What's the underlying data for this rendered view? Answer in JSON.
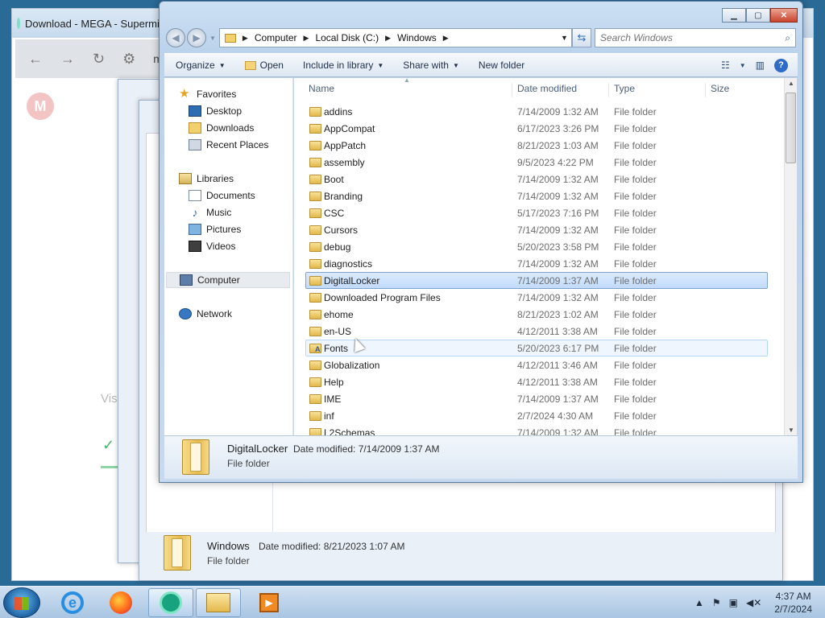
{
  "browser": {
    "tab_title": "Download - MEGA - Supermiu",
    "url_fragment": "me",
    "logo_letter": "M",
    "partial_text": "Vis"
  },
  "ghost_details": {
    "name": "Windows",
    "modified": "Date modified: 8/21/2023 1:07 AM",
    "type": "File folder"
  },
  "explorer": {
    "address": [
      "Computer",
      "Local Disk (C:)",
      "Windows"
    ],
    "search_placeholder": "Search Windows",
    "toolbar": {
      "organize": "Organize",
      "open": "Open",
      "include_in_library": "Include in library",
      "share_with": "Share with",
      "new_folder": "New folder"
    },
    "nav": {
      "favorites": "Favorites",
      "desktop": "Desktop",
      "downloads": "Downloads",
      "recent_places": "Recent Places",
      "libraries": "Libraries",
      "documents": "Documents",
      "music": "Music",
      "pictures": "Pictures",
      "videos": "Videos",
      "computer": "Computer",
      "network": "Network"
    },
    "columns": {
      "name": "Name",
      "date_modified": "Date modified",
      "type": "Type",
      "size": "Size"
    },
    "files": [
      {
        "name": "addins",
        "date": "7/14/2009 1:32 AM",
        "type": "File folder"
      },
      {
        "name": "AppCompat",
        "date": "6/17/2023 3:26 PM",
        "type": "File folder"
      },
      {
        "name": "AppPatch",
        "date": "8/21/2023 1:03 AM",
        "type": "File folder"
      },
      {
        "name": "assembly",
        "date": "9/5/2023 4:22 PM",
        "type": "File folder"
      },
      {
        "name": "Boot",
        "date": "7/14/2009 1:32 AM",
        "type": "File folder"
      },
      {
        "name": "Branding",
        "date": "7/14/2009 1:32 AM",
        "type": "File folder"
      },
      {
        "name": "CSC",
        "date": "5/17/2023 7:16 PM",
        "type": "File folder"
      },
      {
        "name": "Cursors",
        "date": "7/14/2009 1:32 AM",
        "type": "File folder"
      },
      {
        "name": "debug",
        "date": "5/20/2023 3:58 PM",
        "type": "File folder"
      },
      {
        "name": "diagnostics",
        "date": "7/14/2009 1:32 AM",
        "type": "File folder"
      },
      {
        "name": "DigitalLocker",
        "date": "7/14/2009 1:37 AM",
        "type": "File folder"
      },
      {
        "name": "Downloaded Program Files",
        "date": "7/14/2009 1:32 AM",
        "type": "File folder"
      },
      {
        "name": "ehome",
        "date": "8/21/2023 1:02 AM",
        "type": "File folder"
      },
      {
        "name": "en-US",
        "date": "4/12/2011 3:38 AM",
        "type": "File folder"
      },
      {
        "name": "Fonts",
        "date": "5/20/2023 6:17 PM",
        "type": "File folder"
      },
      {
        "name": "Globalization",
        "date": "4/12/2011 3:46 AM",
        "type": "File folder"
      },
      {
        "name": "Help",
        "date": "4/12/2011 3:38 AM",
        "type": "File folder"
      },
      {
        "name": "IME",
        "date": "7/14/2009 1:37 AM",
        "type": "File folder"
      },
      {
        "name": "inf",
        "date": "2/7/2024 4:30 AM",
        "type": "File folder"
      },
      {
        "name": "L2Schemas",
        "date": "7/14/2009 1:32 AM",
        "type": "File folder"
      }
    ],
    "details": {
      "name": "DigitalLocker",
      "modified": "Date modified: 7/14/2009 1:37 AM",
      "type": "File folder"
    }
  },
  "taskbar": {
    "time": "4:37 AM",
    "date": "2/7/2024"
  }
}
